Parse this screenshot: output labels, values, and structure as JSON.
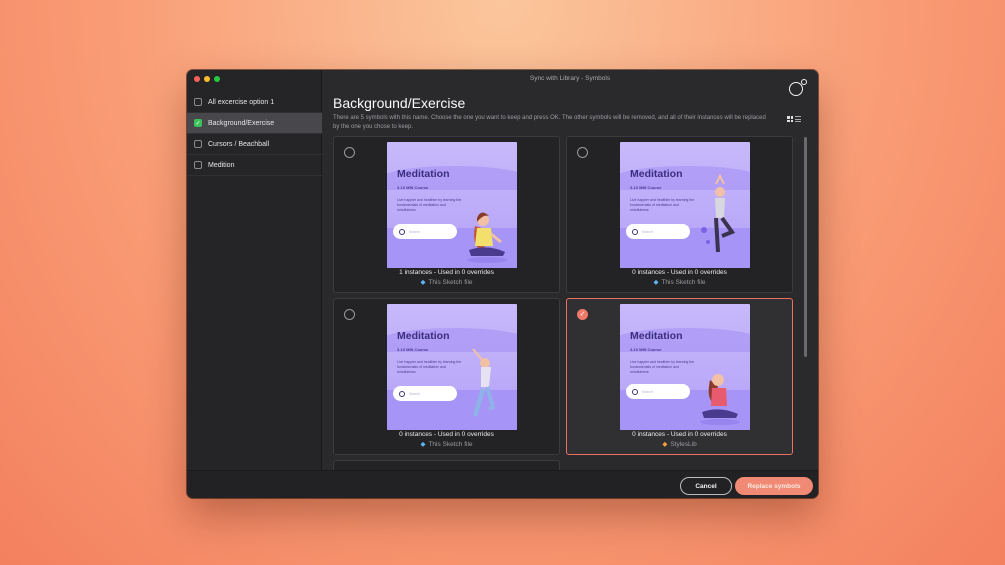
{
  "window": {
    "title": "Sync with Library - Symbols"
  },
  "sidebar": {
    "items": [
      {
        "label": "All excercise option 1",
        "checked": false,
        "active": false
      },
      {
        "label": "Background/Exercise",
        "checked": true,
        "active": true
      },
      {
        "label": "Cursors / Beachball",
        "checked": false,
        "active": false
      },
      {
        "label": "Medition",
        "checked": false,
        "active": false
      }
    ]
  },
  "main": {
    "heading": "Background/Exercise",
    "description": "There are 5 symbols with this name. Choose the one you want to keep and press OK. The other symbols will be removed, and all of their instances will be replaced by the one you chose to keep."
  },
  "cards": [
    {
      "title": "Meditation",
      "subtitle": "3-10 MIN Course",
      "body": "Live happier and healthier by learning the fundamentals of meditation and mindfulness",
      "search": "Search",
      "caption": "1 instances - Used in 0 overrides",
      "source": "This Sketch file",
      "selected": false
    },
    {
      "title": "Meditation",
      "subtitle": "3-10 MIN Course",
      "body": "Live happier and healthier by learning the fundamentals of meditation and mindfulness",
      "search": "Search",
      "caption": "0 instances - Used in 0 overrides",
      "source": "This Sketch file",
      "selected": false
    },
    {
      "title": "Meditation",
      "subtitle": "3-10 MIN Course",
      "body": "Live happier and healthier by learning the fundamentals of meditation and mindfulness",
      "search": "Search",
      "caption": "0 instances - Used in 0 overrides",
      "source": "This Sketch file",
      "selected": false
    },
    {
      "title": "Meditation",
      "subtitle": "3-10 MIN Course",
      "body": "Live happier and healthier by learning the fundamentals of meditation and mindfulness",
      "search": "Search",
      "caption": "0 instances - Used in 0 overrides",
      "source": "StylesLib",
      "selected": true
    }
  ],
  "footer": {
    "cancel_label": "Cancel",
    "replace_label": "Replace symbols"
  },
  "colors": {
    "accent": "#f08a74",
    "checkbox_green": "#3cc15a",
    "thumb_purple": "#b3a1f7"
  },
  "icons": [
    "abstract-logo-icon",
    "grid-view-icon",
    "list-view-icon",
    "sketch-diamond-icon",
    "library-diamond-icon",
    "search-icon"
  ]
}
